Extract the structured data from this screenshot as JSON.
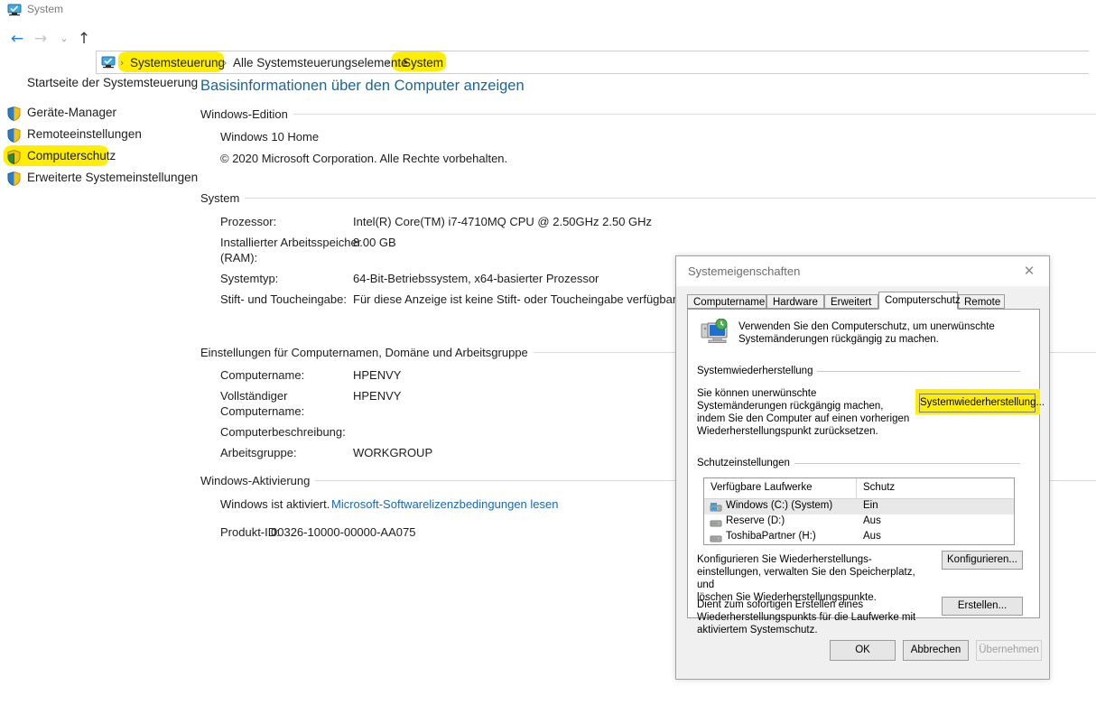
{
  "window": {
    "title": "System",
    "icon": "system-monitor-icon"
  },
  "nav": {
    "back": "←",
    "forward": "→",
    "recent": "⌄",
    "up": "↑",
    "breadcrumb": {
      "separator": "›",
      "items": [
        "Systemsteuerung",
        "Alle Systemsteuerungselemente",
        "System"
      ]
    }
  },
  "sidebar": {
    "home": "Startseite der Systemsteuerung",
    "items": [
      {
        "label": "Geräte-Manager",
        "icon": "shield-icon",
        "highlighted": false
      },
      {
        "label": "Remoteeinstellungen",
        "icon": "shield-icon",
        "highlighted": false
      },
      {
        "label": "Computerschutz",
        "icon": "shield-icon",
        "highlighted": true
      },
      {
        "label": "Erweiterte Systemeinstellungen",
        "icon": "shield-icon",
        "highlighted": false
      }
    ]
  },
  "main": {
    "page_title": "Basisinformationen über den Computer anzeigen",
    "sections": {
      "edition": {
        "header": "Windows-Edition",
        "line1": "Windows 10 Home",
        "line2": "© 2020 Microsoft Corporation. Alle Rechte vorbehalten."
      },
      "system": {
        "header": "System",
        "rows": [
          {
            "label": "Prozessor:",
            "value": "Intel(R) Core(TM) i7-4710MQ CPU @ 2.50GHz   2.50 GHz"
          },
          {
            "label": "Installierter Arbeitsspeicher\n(RAM):",
            "value": "8.00 GB"
          },
          {
            "label": "Systemtyp:",
            "value": "64-Bit-Betriebssystem, x64-basierter Prozessor"
          },
          {
            "label": "Stift- und Toucheingabe:",
            "value": "Für diese Anzeige ist keine Stift- oder Toucheingabe verfügbar."
          }
        ]
      },
      "computername": {
        "header": "Einstellungen für Computernamen, Domäne und Arbeitsgruppe",
        "rows": [
          {
            "label": "Computername:",
            "value": "HPENVY"
          },
          {
            "label": "Vollständiger\nComputername:",
            "value": "HPENVY"
          },
          {
            "label": "Computerbeschreibung:",
            "value": ""
          },
          {
            "label": "Arbeitsgruppe:",
            "value": "WORKGROUP"
          }
        ]
      },
      "activation": {
        "header": "Windows-Aktivierung",
        "status": "Windows ist aktiviert.",
        "link": "Microsoft-Softwarelizenzbedingungen lesen",
        "product_id_label": "Produkt-ID:",
        "product_id_value": "00326-10000-00000-AA075"
      }
    }
  },
  "dialog": {
    "title": "Systemeigenschaften",
    "close_icon": "close-icon",
    "tabs": [
      {
        "label": "Computername",
        "active": false
      },
      {
        "label": "Hardware",
        "active": false
      },
      {
        "label": "Erweitert",
        "active": false
      },
      {
        "label": "Computerschutz",
        "active": true
      },
      {
        "label": "Remote",
        "active": false
      }
    ],
    "intro": "Verwenden Sie den Computerschutz, um unerwünschte\nSystemänderungen rückgängig zu machen.",
    "intro_icon": "system-restore-icon",
    "restore": {
      "header": "Systemwiederherstellung",
      "description": "Sie können unerwünschte\nSystemänderungen rückgängig machen,\nindem Sie den Computer auf einen vorherigen\nWiederherstellungspunkt zurücksetzen.",
      "button": "Systemwiederherstellung...",
      "button_highlighted": true
    },
    "protection": {
      "header": "Schutzeinstellungen",
      "columns": [
        "Verfügbare Laufwerke",
        "Schutz"
      ],
      "drives": [
        {
          "name": "Windows (C:) (System)",
          "protection": "Ein",
          "icon": "system-drive-icon",
          "selected": true
        },
        {
          "name": "Reserve (D:)",
          "protection": "Aus",
          "icon": "drive-icon",
          "selected": false
        },
        {
          "name": "ToshibaPartner (H:)",
          "protection": "Aus",
          "icon": "drive-icon",
          "selected": false
        }
      ]
    },
    "configure": {
      "description": "Konfigurieren Sie Wiederherstellungs-\neinstellungen, verwalten Sie den Speicherplatz, und\nlöschen Sie Wiederherstellungspunkte.",
      "button": "Konfigurieren..."
    },
    "create": {
      "description": "Dient zum sofortigen Erstellen eines\nWiederherstellungspunkts für die Laufwerke mit\naktiviertem Systemschutz.",
      "button": "Erstellen..."
    },
    "footer": {
      "ok": "OK",
      "cancel": "Abbrechen",
      "apply": "Übernehmen",
      "apply_disabled": true
    }
  },
  "colors": {
    "highlight": "#ffee00",
    "link": "#1868b7",
    "title_blue": "#19669e",
    "nav_back": "#1a7fd4"
  }
}
